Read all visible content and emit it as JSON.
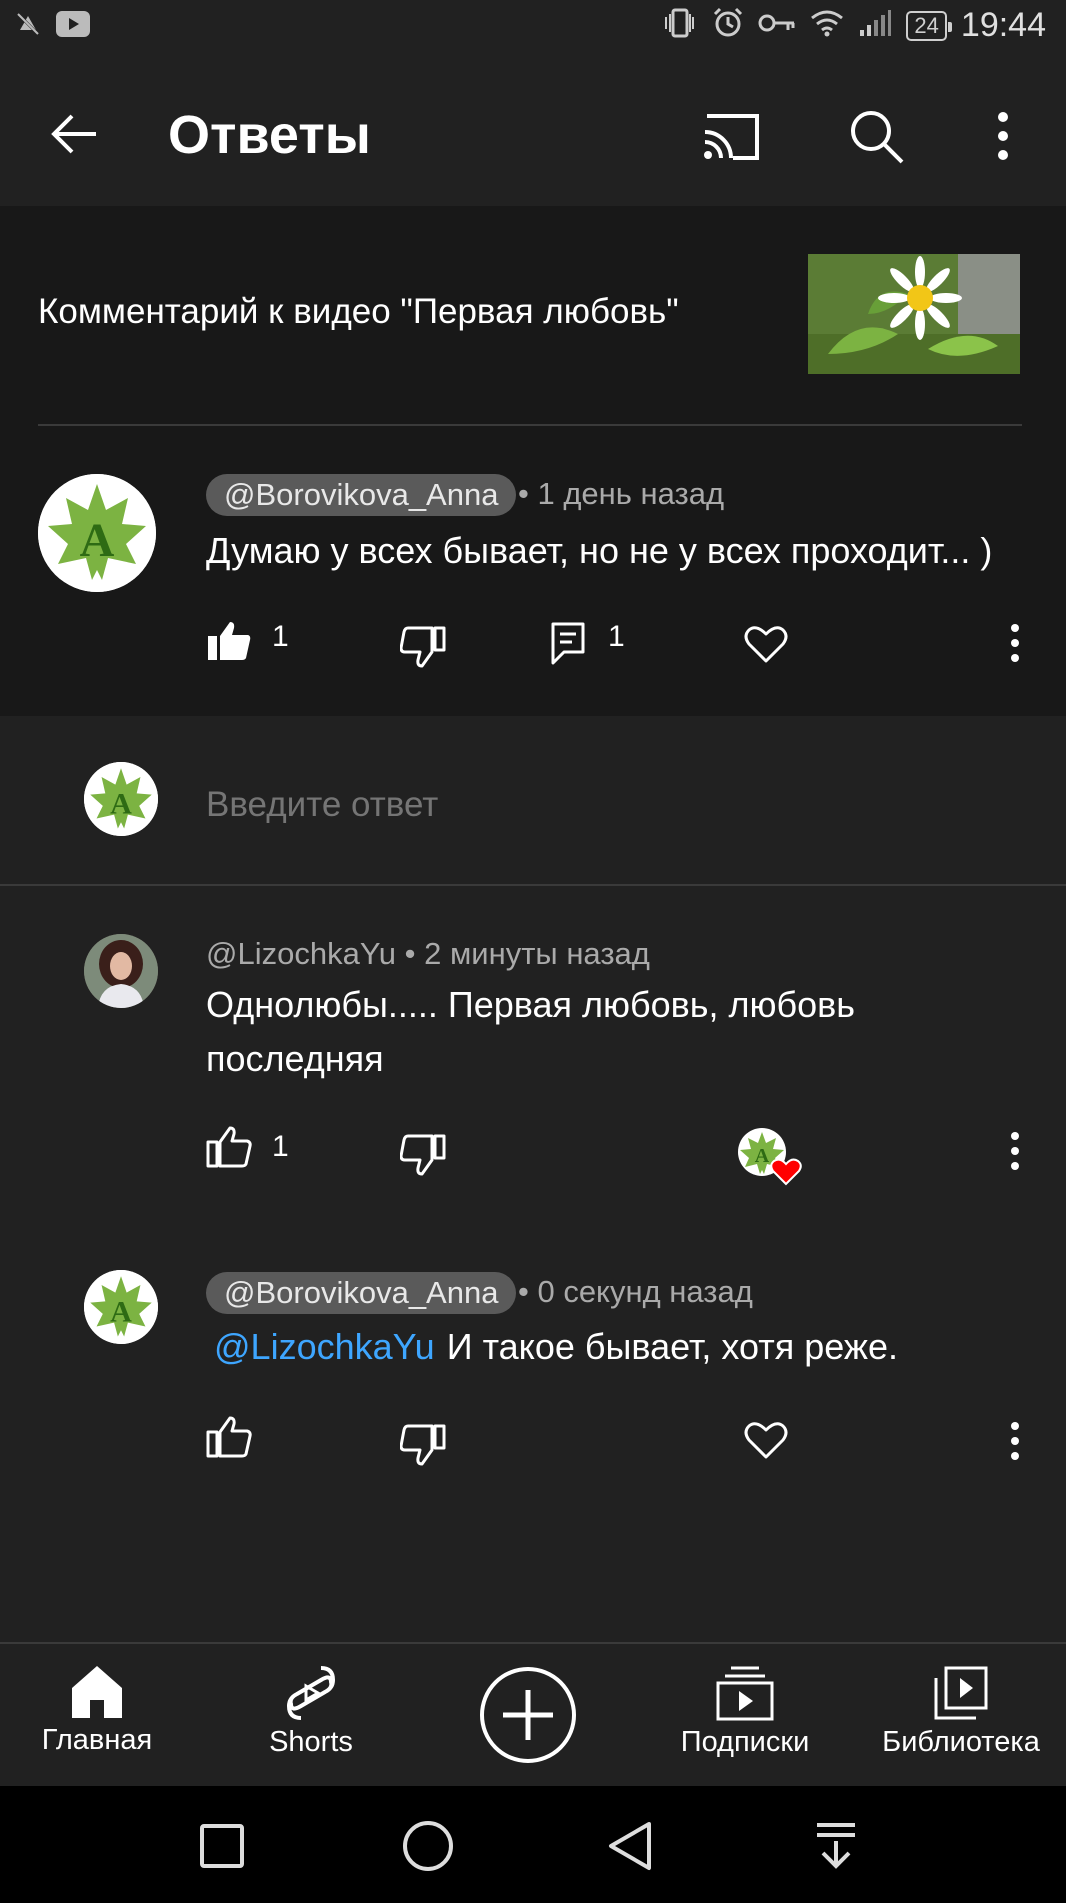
{
  "status_bar": {
    "time": "19:44",
    "battery": "24"
  },
  "app_bar": {
    "title": "Ответы"
  },
  "video": {
    "reference": "Комментарий к видео \"Первая любовь\""
  },
  "main_comment": {
    "author": "@Borovikova_Anna",
    "time": "• 1 день назад",
    "text": "Думаю у всех бывает, но не у всех проходит... )",
    "likes": "1",
    "replies": "1"
  },
  "reply_box": {
    "placeholder": "Введите ответ"
  },
  "replies": [
    {
      "author": "@LizochkaYu",
      "time": "• 2 минуты назад",
      "text": "Однолюбы..... Первая любовь, любовь последняя",
      "likes": "1"
    },
    {
      "author": "@Borovikova_Anna",
      "time": "• 0 секунд назад",
      "mention": "@LizochkaYu",
      "text": "И такое бывает, хотя реже."
    }
  ],
  "bottom_nav": {
    "home": "Главная",
    "shorts": "Shorts",
    "subscriptions": "Подписки",
    "library": "Библиотека"
  },
  "colors": {
    "background": "#212121",
    "card": "#181818",
    "mention": "#3ea6ff",
    "heart_red": "#ff0000"
  }
}
